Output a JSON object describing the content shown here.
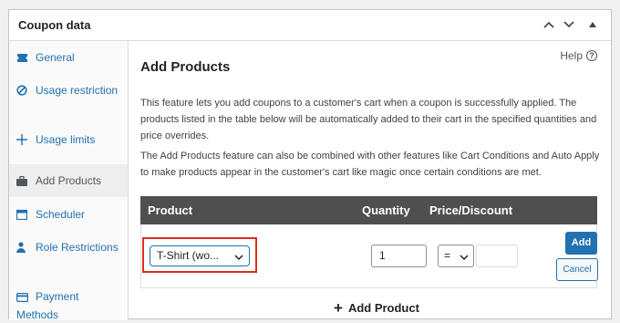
{
  "panel": {
    "title": "Coupon data"
  },
  "sidebar": {
    "items": [
      {
        "label": "General",
        "icon": "ticket-icon"
      },
      {
        "label": "Usage restriction",
        "icon": "ban-icon"
      },
      {
        "label": "Usage limits",
        "icon": "plus-arrows-icon"
      },
      {
        "label": "Add Products",
        "icon": "briefcase-icon",
        "active": true
      },
      {
        "label": "Scheduler",
        "icon": "calendar-icon"
      },
      {
        "label": "Role Restrictions",
        "icon": "user-icon"
      },
      {
        "label": "Payment Methods",
        "icon": "card-icon"
      }
    ]
  },
  "content": {
    "help_label": "Help",
    "title": "Add Products",
    "paragraph1": "This feature lets you add coupons to a customer's cart when a coupon is successfully applied. The products listed in the table below will be automatically added to their cart in the specified quantities and price overrides.",
    "paragraph2": "The Add Products feature can also be combined with other features like Cart Conditions and Auto Apply to make products appear in the customer's cart like magic once certain conditions are met.",
    "table": {
      "headers": [
        "Product",
        "Quantity",
        "Price/Discount"
      ],
      "row": {
        "product": "T-Shirt (wo...",
        "quantity": "1",
        "discount_operator": "=",
        "discount_value": ""
      },
      "add_button": "Add",
      "cancel_button": "Cancel"
    },
    "add_product_label": "Add Product"
  },
  "colors": {
    "accent": "#2271b1",
    "highlight": "#e02b20",
    "table_header": "#4f4f4f"
  }
}
